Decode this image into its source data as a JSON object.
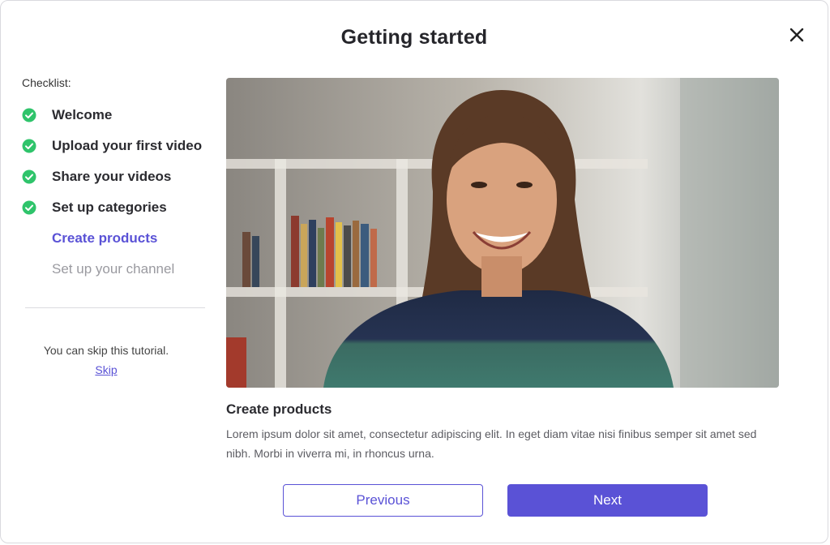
{
  "dialog": {
    "title": "Getting started"
  },
  "checklist": {
    "label": "Checklist:",
    "items": [
      {
        "label": "Welcome",
        "status": "done"
      },
      {
        "label": "Upload your first video",
        "status": "done"
      },
      {
        "label": "Share your videos",
        "status": "done"
      },
      {
        "label": "Set up categories",
        "status": "done"
      },
      {
        "label": "Create products",
        "status": "current"
      },
      {
        "label": "Set up your channel",
        "status": "pending"
      }
    ]
  },
  "skip": {
    "text": "You can skip this tutorial.",
    "link_label": "Skip"
  },
  "step": {
    "title": "Create products",
    "description": "Lorem ipsum dolor sit amet, consectetur adipiscing elit. In eget diam vitae nisi finibus semper sit amet sed nibh. Morbi in viverra mi, in rhoncus urna."
  },
  "buttons": {
    "previous_label": "Previous",
    "next_label": "Next"
  },
  "colors": {
    "accent": "#5a52d6",
    "done_check": "#2fc46b",
    "pending_text": "#9a9aa0"
  },
  "icons": {
    "close": "close-icon",
    "done": "check-circle-icon"
  }
}
